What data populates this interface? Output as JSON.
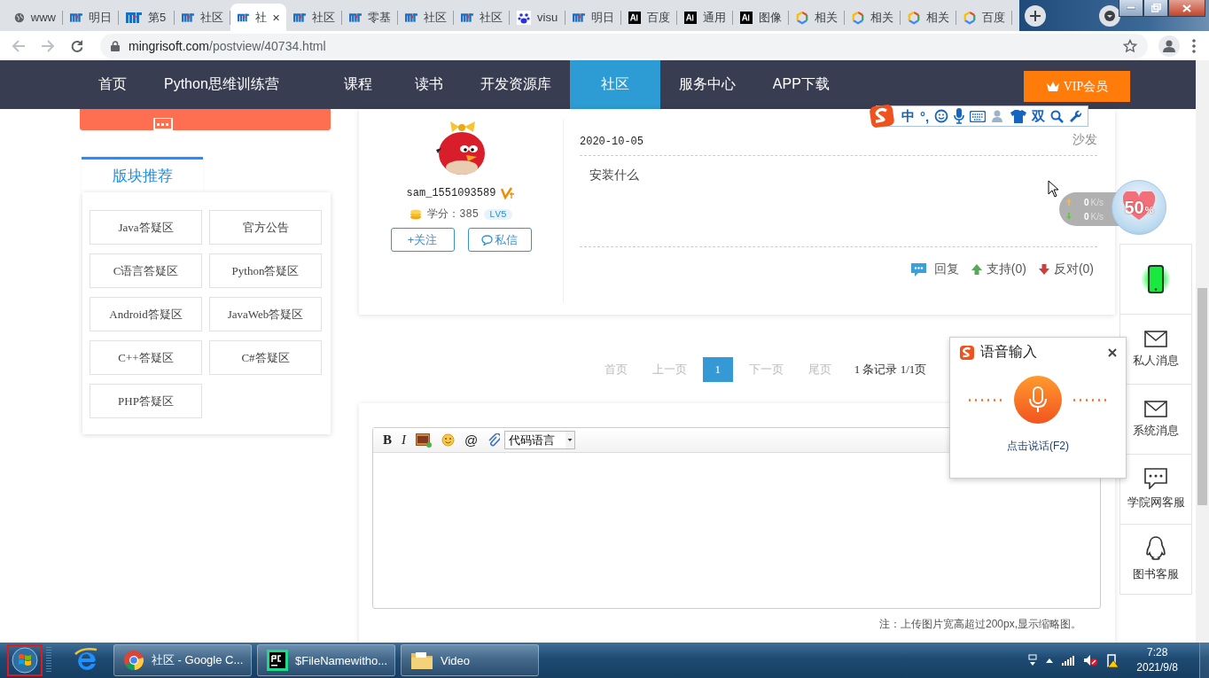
{
  "browser": {
    "tabs": [
      {
        "label": "www",
        "kind": "globe",
        "selected": false
      },
      {
        "label": "明日",
        "kind": "mr",
        "selected": false
      },
      {
        "label": "第5",
        "kind": "mr",
        "selected": false
      },
      {
        "label": "社区",
        "kind": "mr",
        "selected": false
      },
      {
        "label": "社",
        "kind": "mr",
        "selected": true
      },
      {
        "label": "社区",
        "kind": "mr",
        "selected": false
      },
      {
        "label": "零基",
        "kind": "mr",
        "selected": false
      },
      {
        "label": "社区",
        "kind": "mr",
        "selected": false
      },
      {
        "label": "社区",
        "kind": "mr",
        "selected": false
      },
      {
        "label": "visu",
        "kind": "baidu",
        "selected": false
      },
      {
        "label": "明日",
        "kind": "mr",
        "selected": false
      },
      {
        "label": "百度",
        "kind": "ai",
        "selected": false
      },
      {
        "label": "通用",
        "kind": "ai",
        "selected": false
      },
      {
        "label": "图像",
        "kind": "ai",
        "selected": false
      },
      {
        "label": "相关",
        "kind": "hex",
        "selected": false
      },
      {
        "label": "相关",
        "kind": "hex",
        "selected": false
      },
      {
        "label": "相关",
        "kind": "hex",
        "selected": false
      },
      {
        "label": "百度",
        "kind": "hex",
        "selected": false
      }
    ],
    "url_host": "mingrisoft.com",
    "url_path": "/postview/40734.html"
  },
  "nav": {
    "items": [
      {
        "label": "首页",
        "selected": false
      },
      {
        "label": "Python思维训练营",
        "selected": false
      },
      {
        "label": "课程",
        "selected": false
      },
      {
        "label": "读书",
        "selected": false
      },
      {
        "label": "开发资源库",
        "selected": false
      },
      {
        "label": "社区",
        "selected": true
      },
      {
        "label": "服务中心",
        "selected": false
      },
      {
        "label": "APP下载",
        "selected": false
      }
    ],
    "vip": "VIP会员"
  },
  "sidebar": {
    "title": "版块推荐",
    "boards": [
      "Java答疑区",
      "官方公告",
      "C语言答疑区",
      "Python答疑区",
      "Android答疑区",
      "JavaWeb答疑区",
      "C++答疑区",
      "C#答疑区",
      "PHP答疑区"
    ]
  },
  "post": {
    "username": "sam_1551093589",
    "score_label": "学分：385",
    "level": "LV5",
    "follow": "+关注",
    "message": "私信",
    "date": "2020-10-05",
    "floor": "沙发",
    "content": "安装什么",
    "reply": "回复",
    "support": "支持(0)",
    "oppose": "反对(0)"
  },
  "pagination": {
    "first": "首页",
    "prev": "上一页",
    "pages": [
      {
        "label": "1",
        "selected": true
      }
    ],
    "next": "下一页",
    "last": "尾页",
    "summary": "1 条记录 1/1页"
  },
  "editor": {
    "bold": "B",
    "italic": "I",
    "at": "@",
    "code_select": "代码语言",
    "note": "注：上传图片宽高超过200px,显示缩略图。"
  },
  "rail": [
    {
      "kind": "phone"
    },
    {
      "kind": "mail",
      "label": "私人消息"
    },
    {
      "kind": "mail",
      "label": "系统消息"
    },
    {
      "kind": "chat",
      "label": "学院网客服"
    },
    {
      "kind": "qq",
      "label": "图书客服"
    }
  ],
  "ime": {
    "mode": "中",
    "punct": "°,",
    "shuangpin": "双"
  },
  "voice": {
    "title": "语音输入",
    "hint": "点击说话(F2)"
  },
  "speed": {
    "up": {
      "value": "0",
      "unit": "K/s"
    },
    "down": {
      "value": "0",
      "unit": "K/s"
    },
    "percent": "50",
    "percent_sign": "%"
  },
  "taskbar": {
    "tasks": [
      {
        "kind": "chrome",
        "label": "社区 - Google C..."
      },
      {
        "kind": "pycharm",
        "label": "$FileNamewitho..."
      },
      {
        "kind": "folder",
        "label": "Video"
      }
    ],
    "time": "7:28",
    "date": "2021/9/8"
  }
}
